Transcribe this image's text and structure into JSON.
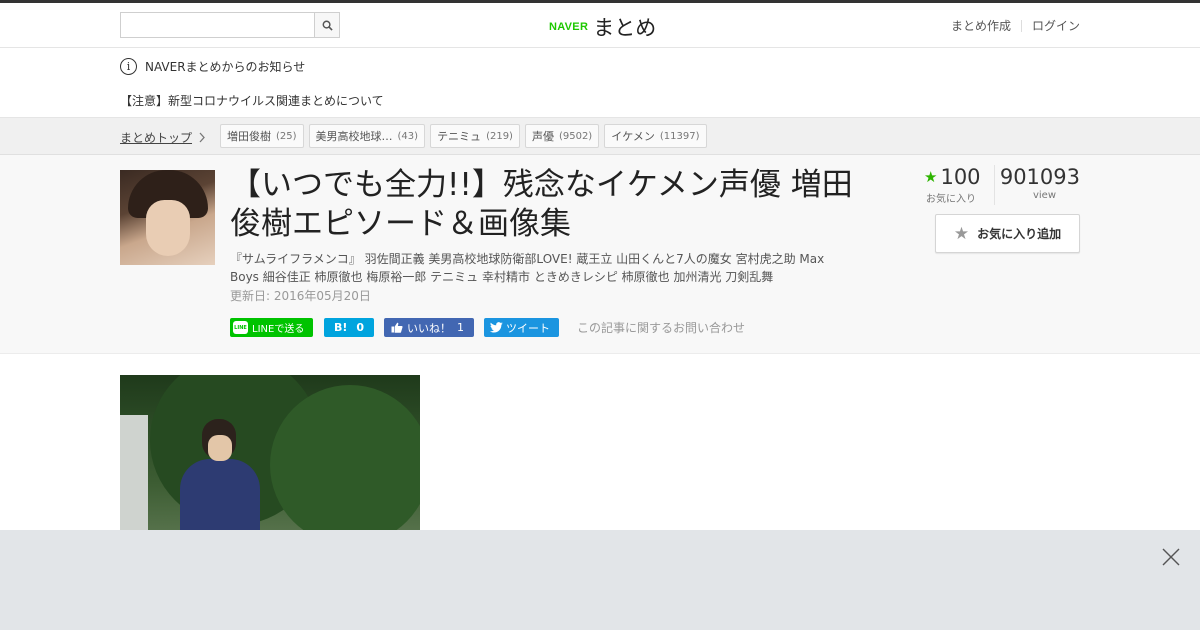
{
  "header": {
    "search": {
      "value": "",
      "placeholder": ""
    },
    "logo": {
      "brand": "NAVER",
      "name": "まとめ"
    },
    "links": {
      "create": "まとめ作成",
      "login": "ログイン"
    }
  },
  "notice": {
    "title": "NAVERまとめからのお知らせ",
    "link": "【注意】新型コロナウイルス関連まとめについて"
  },
  "breadcrumb": {
    "top": "まとめトップ",
    "tags": [
      {
        "label": "増田俊樹",
        "count": "(25)"
      },
      {
        "label": "美男高校地球…",
        "count": "(43)"
      },
      {
        "label": "テニミュ",
        "count": "(219)"
      },
      {
        "label": "声優",
        "count": "(9502)"
      },
      {
        "label": "イケメン",
        "count": "(11397)"
      }
    ]
  },
  "article": {
    "title": "【いつでも全力!!】残念なイケメン声優 増田俊樹エピソード＆画像集",
    "description": "『サムライフラメンコ』 羽佐間正義 美男高校地球防衛部LOVE! 蔵王立 山田くんと7人の魔女 宮村虎之助 Max Boys 細谷佳正 柿原徹也 梅原裕一郎 テニミュ 幸村精市 ときめきレシピ 柿原徹也 加州清光 刀剣乱舞",
    "updated": "更新日: 2016年05月20日",
    "stats": {
      "favorites": "100",
      "favorites_label": "お気に入り",
      "views": "901093",
      "views_label": "view"
    },
    "fav_button": "お気に入り追加",
    "share": {
      "line_badge": "LINE",
      "line": "LINEで送る",
      "hatena_icon": "B!",
      "hatena_count": "0",
      "fb_like": "いいね！",
      "fb_count": "1",
      "tweet": "ツイート",
      "inquiry": "この記事に関するお問い合わせ"
    }
  },
  "icons": {
    "search": "search-icon",
    "info": "info-icon",
    "chevron": "chevron-right-icon",
    "star": "star-icon",
    "close": "close-icon"
  },
  "colors": {
    "naver_green": "#1ec800",
    "line_green": "#00c300",
    "hatena_blue": "#00a4de",
    "facebook_blue": "#4267b2",
    "twitter_blue": "#1b95e0",
    "fav_star_green": "#2db400"
  }
}
